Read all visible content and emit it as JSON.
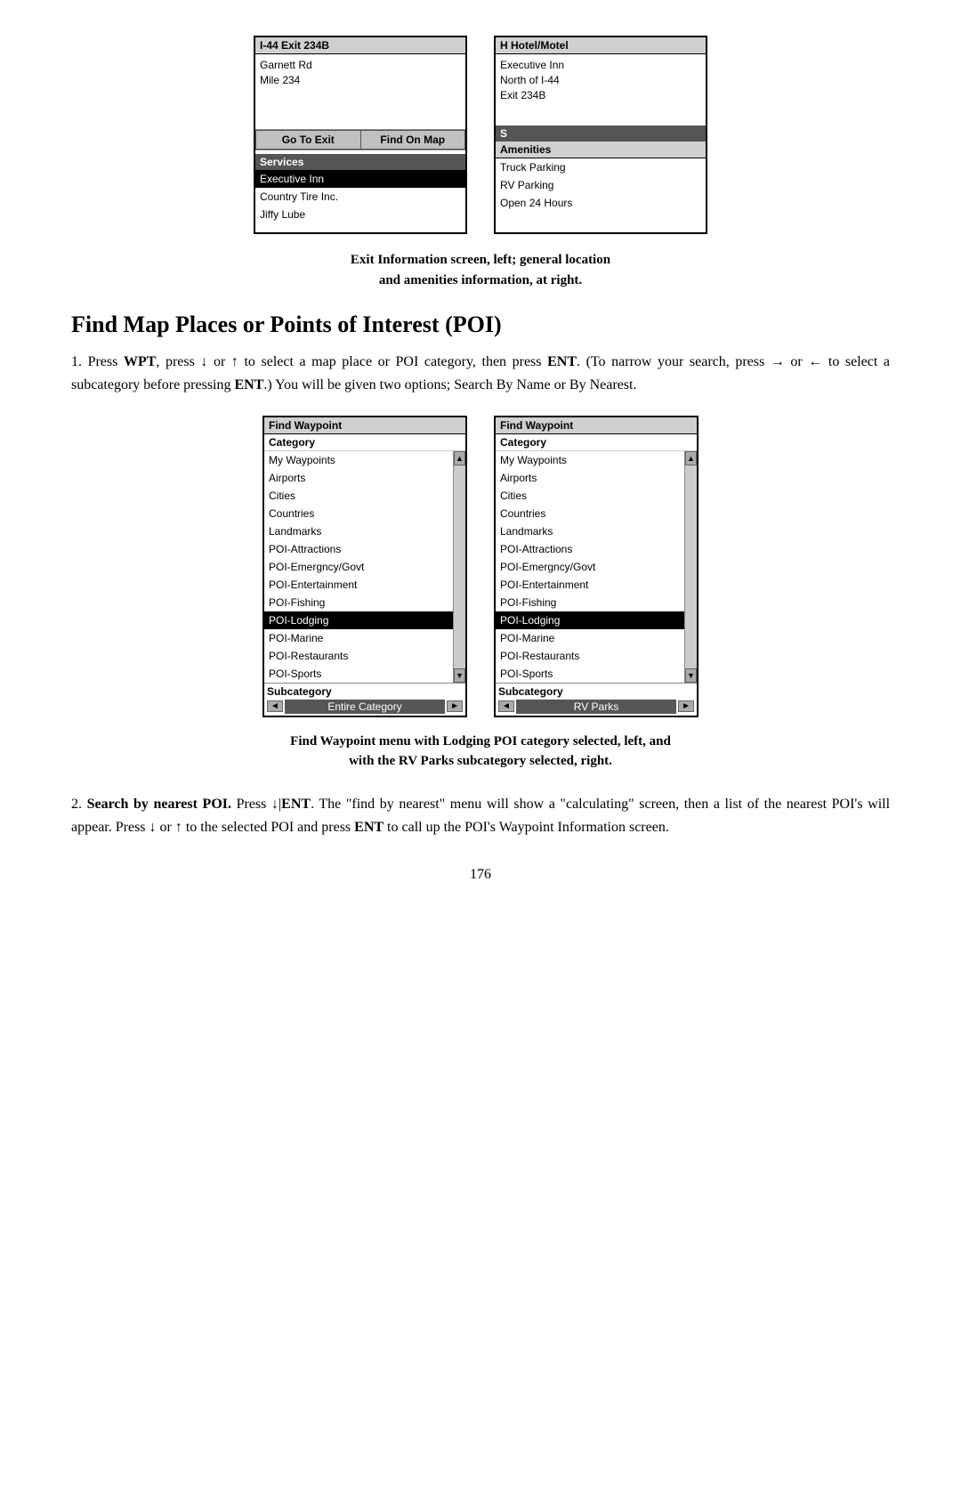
{
  "page": {
    "number": "176"
  },
  "top_caption": {
    "line1": "Exit Information screen, left; general location",
    "line2": "and amenities information, at right."
  },
  "left_screen": {
    "title": "I-44 Exit 234B",
    "info_lines": [
      "Garnett Rd",
      "Mile 234"
    ],
    "buttons": [
      "Go To Exit",
      "Find On Map"
    ],
    "section_label": "Services",
    "services": [
      {
        "text": "Executive Inn",
        "selected": true
      },
      {
        "text": "Country Tire Inc.",
        "selected": false
      },
      {
        "text": "Jiffy Lube",
        "selected": false
      }
    ]
  },
  "right_screen": {
    "title": "H Hotel/Motel",
    "info_lines": [
      "Executive Inn",
      "North of I-44",
      "Exit 234B"
    ],
    "section_label": "S",
    "amenities_label": "Amenities",
    "amenities": [
      {
        "text": "Truck Parking"
      },
      {
        "text": "RV Parking"
      },
      {
        "text": "Open 24 Hours"
      }
    ]
  },
  "section_heading": "Find Map Places or Points of Interest (POI)",
  "body_paragraph1": {
    "text_parts": [
      {
        "type": "normal",
        "text": "1. Press "
      },
      {
        "type": "bold",
        "text": "WPT"
      },
      {
        "type": "normal",
        "text": ", press ↓ or ↑ to select a map place or POI category, then press "
      },
      {
        "type": "bold",
        "text": "ENT"
      },
      {
        "type": "normal",
        "text": ". (To narrow your search, press → or ← to select a subcategory before pressing "
      },
      {
        "type": "bold",
        "text": "ENT"
      },
      {
        "type": "normal",
        "text": ".) You will be given two options; Search By Name or By Nearest."
      }
    ]
  },
  "waypoint_caption": {
    "line1": "Find Waypoint menu with Lodging POI category selected, left, and",
    "line2": "with the RV Parks subcategory selected, right."
  },
  "left_wp_screen": {
    "title": "Find Waypoint",
    "category_label": "Category",
    "items": [
      "My Waypoints",
      "Airports",
      "Cities",
      "Countries",
      "Landmarks",
      "POI-Attractions",
      "POI-Emergncy/Govt",
      "POI-Entertainment",
      "POI-Fishing",
      "POI-Lodging",
      "POI-Marine",
      "POI-Restaurants",
      "POI-Sports"
    ],
    "selected_item": "POI-Lodging",
    "subcategory_label": "Subcategory",
    "subcategory_value": "Entire Category"
  },
  "right_wp_screen": {
    "title": "Find Waypoint",
    "category_label": "Category",
    "items": [
      "My Waypoints",
      "Airports",
      "Cities",
      "Countries",
      "Landmarks",
      "POI-Attractions",
      "POI-Emergncy/Govt",
      "POI-Entertainment",
      "POI-Fishing",
      "POI-Lodging",
      "POI-Marine",
      "POI-Restaurants",
      "POI-Sports"
    ],
    "selected_item": "POI-Lodging",
    "subcategory_label": "Subcategory",
    "subcategory_value": "RV Parks"
  },
  "body_paragraph2": {
    "text_parts": [
      {
        "type": "normal",
        "text": "2. "
      },
      {
        "type": "bold",
        "text": "Search by nearest POI."
      },
      {
        "type": "normal",
        "text": " Press ↓|"
      },
      {
        "type": "bold",
        "text": "ENT"
      },
      {
        "type": "normal",
        "text": ". The \"find by nearest\" menu will show a \"calculating\" screen, then a list of the nearest POI's will appear. Press ↓ or ↑ to the selected POI and press "
      },
      {
        "type": "bold",
        "text": "ENT"
      },
      {
        "type": "normal",
        "text": " to call up the POI's Waypoint Information screen."
      }
    ]
  }
}
